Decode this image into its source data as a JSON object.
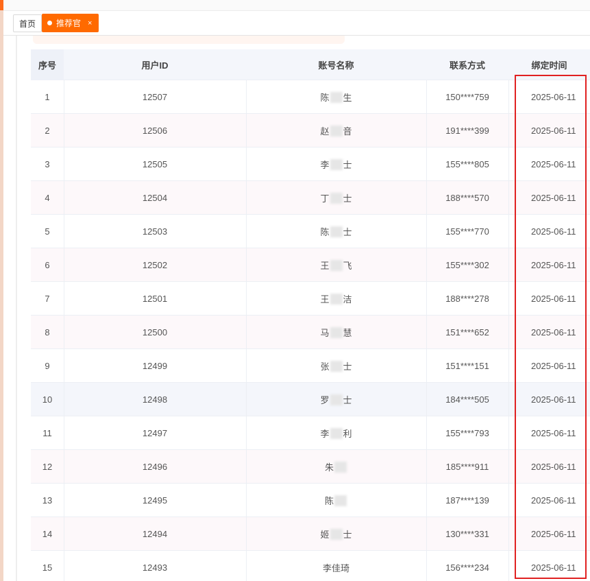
{
  "tabs": {
    "home_label": "首页",
    "active_label": "推荐官",
    "close_glyph": "×"
  },
  "table": {
    "headers": [
      "序号",
      "用户ID",
      "账号名称",
      "联系方式",
      "绑定时间"
    ],
    "rows": [
      {
        "no": "1",
        "uid": "12507",
        "name_first": "陈",
        "name_last": "生",
        "phone": "150****759",
        "date": "2025-06-11"
      },
      {
        "no": "2",
        "uid": "12506",
        "name_first": "赵",
        "name_last": "音",
        "phone": "191****399",
        "date": "2025-06-11"
      },
      {
        "no": "3",
        "uid": "12505",
        "name_first": "李",
        "name_last": "士",
        "phone": "155****805",
        "date": "2025-06-11"
      },
      {
        "no": "4",
        "uid": "12504",
        "name_first": "丁",
        "name_last": "士",
        "phone": "188****570",
        "date": "2025-06-11"
      },
      {
        "no": "5",
        "uid": "12503",
        "name_first": "陈",
        "name_last": "士",
        "phone": "155****770",
        "date": "2025-06-11"
      },
      {
        "no": "6",
        "uid": "12502",
        "name_first": "王",
        "name_last": "飞",
        "phone": "155****302",
        "date": "2025-06-11"
      },
      {
        "no": "7",
        "uid": "12501",
        "name_first": "王",
        "name_last": "洁",
        "phone": "188****278",
        "date": "2025-06-11"
      },
      {
        "no": "8",
        "uid": "12500",
        "name_first": "马",
        "name_last": "慧",
        "phone": "151****652",
        "date": "2025-06-11"
      },
      {
        "no": "9",
        "uid": "12499",
        "name_first": "张",
        "name_last": "士",
        "phone": "151****151",
        "date": "2025-06-11"
      },
      {
        "no": "10",
        "uid": "12498",
        "name_first": "罗",
        "name_last": "士",
        "phone": "184****505",
        "date": "2025-06-11"
      },
      {
        "no": "11",
        "uid": "12497",
        "name_first": "李",
        "name_last": "利",
        "phone": "155****793",
        "date": "2025-06-11"
      },
      {
        "no": "12",
        "uid": "12496",
        "name_first": "朱",
        "name_last": "",
        "phone": "185****911",
        "date": "2025-06-11"
      },
      {
        "no": "13",
        "uid": "12495",
        "name_first": "陈",
        "name_last": "",
        "phone": "187****139",
        "date": "2025-06-11"
      },
      {
        "no": "14",
        "uid": "12494",
        "name_first": "姬",
        "name_last": "士",
        "phone": "130****331",
        "date": "2025-06-11"
      },
      {
        "no": "15",
        "uid": "12493",
        "name_first": "李佳琦",
        "name_last": "",
        "phone": "156****234",
        "date": "2025-06-11"
      }
    ]
  },
  "colors": {
    "accent": "#ff6a00",
    "highlight_box": "#e02020"
  }
}
